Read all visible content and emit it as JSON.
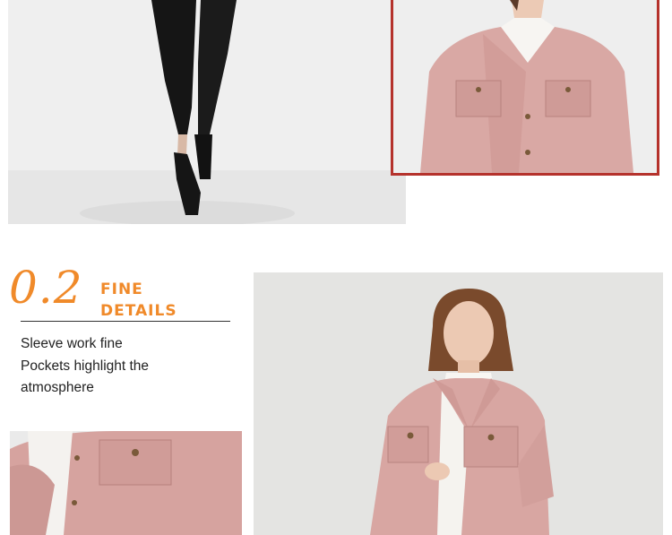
{
  "section": {
    "number": "0.2",
    "title_line1": "FINE",
    "title_line2": "DETAILS",
    "description": [
      "Sleeve work fine",
      "Pockets highlight the",
      "atmosphere"
    ]
  },
  "colors": {
    "accent": "#f08a2a",
    "frame": "#b5322c",
    "coat": "#d9a8a4"
  },
  "images": [
    {
      "name": "legs-and-heels-photo"
    },
    {
      "name": "pink-coat-front-photo"
    },
    {
      "name": "model-in-pink-coat-photo"
    },
    {
      "name": "pocket-detail-photo"
    }
  ]
}
